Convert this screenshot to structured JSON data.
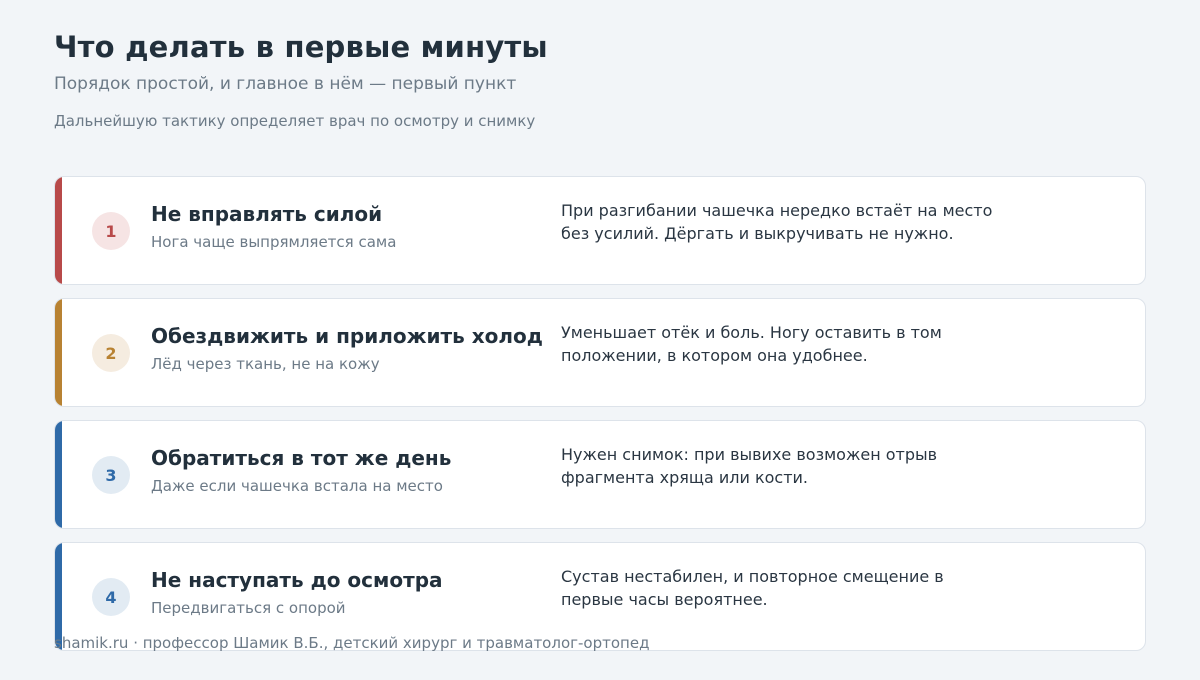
{
  "header": {
    "title": "Что делать в первые минуты",
    "subtitle": "Порядок простой, и главное в нём — первый пункт",
    "note": "Дальнейшую тактику определяет врач по осмотру и снимку"
  },
  "steps": [
    {
      "number": "1",
      "heading": "Не вправлять силой",
      "subheading": "Нога чаще выпрямляется сама",
      "description": "При разгибании чашечка нередко встаёт на место без усилий. Дёргать и выкручивать не нужно.",
      "accent_color": "#b84a4a",
      "badge_bg": "#f6e4e4",
      "badge_color": "#b84a4a"
    },
    {
      "number": "2",
      "heading": "Обездвижить и приложить холод",
      "subheading": "Лёд через ткань, не на кожу",
      "description": "Уменьшает отёк и боль. Ногу оставить в том положении, в котором она удобнее.",
      "accent_color": "#b88232",
      "badge_bg": "#f5ece0",
      "badge_color": "#b88232"
    },
    {
      "number": "3",
      "heading": "Обратиться в тот же день",
      "subheading": "Даже если чашечка встала на место",
      "description": "Нужен снимок: при вывихе возможен отрыв фрагмента хряща или кости.",
      "accent_color": "#2f6aa8",
      "badge_bg": "#e2ebf3",
      "badge_color": "#2f6aa8"
    },
    {
      "number": "4",
      "heading": "Не наступать до осмотра",
      "subheading": "Передвигаться с опорой",
      "description": "Сустав нестабилен, и повторное смещение в первые часы вероятнее.",
      "accent_color": "#2f6aa8",
      "badge_bg": "#e2ebf3",
      "badge_color": "#2f6aa8"
    }
  ],
  "footer": {
    "text": "shamik.ru · профессор Шамик В.Б., детский хирург и травматолог-ортопед"
  }
}
